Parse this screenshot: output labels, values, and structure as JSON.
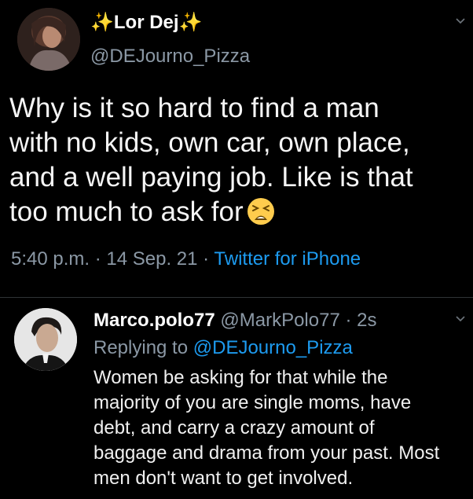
{
  "tweet": {
    "sparkle_left": "✨",
    "display_name": "Lor Dej",
    "sparkle_right": "✨",
    "handle": "@DEJourno_Pizza",
    "text_lines": [
      "Why is it so hard to find a man",
      "with no kids, own car, own place,",
      "and a well paying job. Like is that",
      "too much to ask for"
    ],
    "emoji": "tired-face",
    "time": "5:40 p.m.",
    "sep1": " · ",
    "date": "14 Sep. 21",
    "sep2": " · ",
    "source": "Twitter for iPhone"
  },
  "reply": {
    "display_name": "Marco.polo77",
    "handle": "@MarkPolo77",
    "sep": " · ",
    "age": "2s",
    "replying_prefix": "Replying to ",
    "replying_to": "@DEJourno_Pizza",
    "text_lines": [
      "Women be asking for that while the",
      "majority of you are single moms, have",
      "debt, and carry a crazy amount of",
      "baggage and drama from your past. Most",
      "men don't want to get involved."
    ]
  },
  "colors": {
    "background": "#000000",
    "text": "#e7e9ea",
    "muted": "#8b98a5",
    "link": "#1d9bf0",
    "divider": "#2f3336"
  }
}
